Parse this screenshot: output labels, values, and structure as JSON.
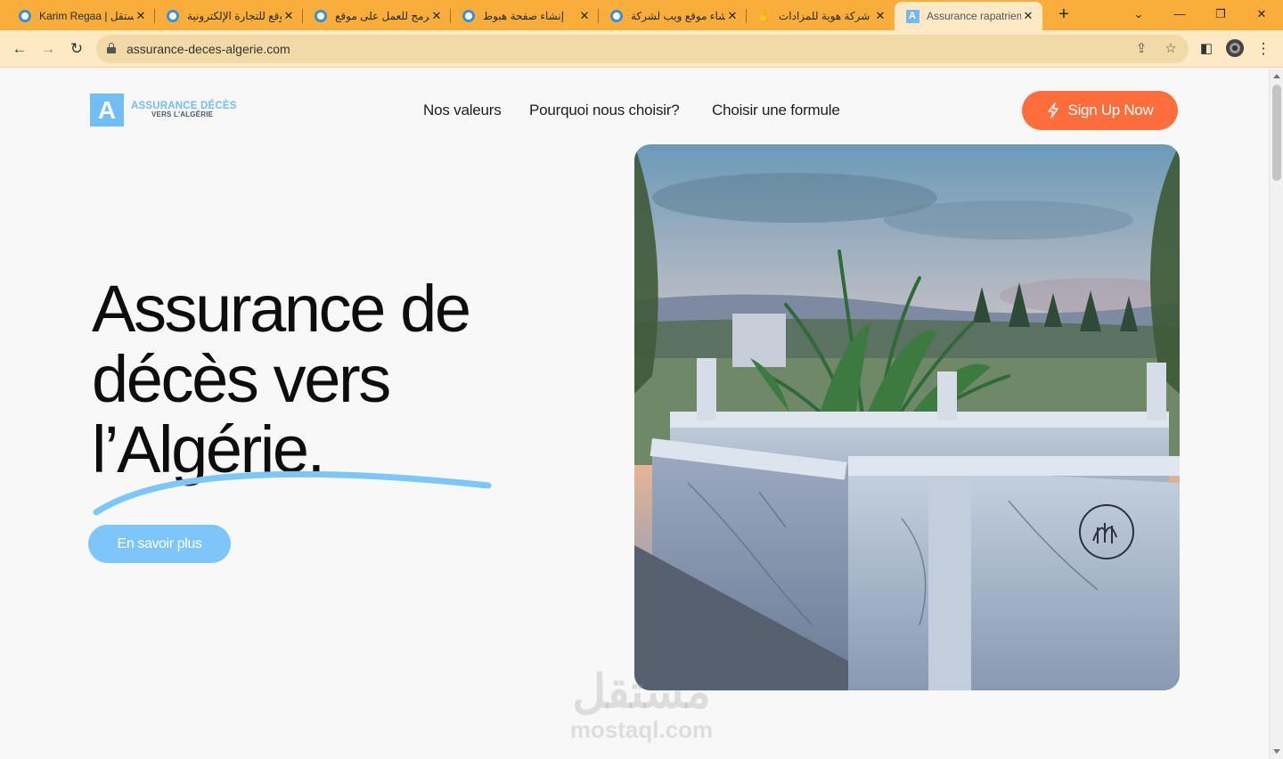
{
  "browser": {
    "tabs": [
      {
        "title": "Karim Regaa | مستقل",
        "favicon": "mostaql-ring-icon",
        "active": false
      },
      {
        "title": "موقع للتجارة الإلكترونية",
        "favicon": "mostaql-ring-icon",
        "active": false
      },
      {
        "title": "مبرمج للعمل على موقع",
        "favicon": "mostaql-ring-icon",
        "active": false
      },
      {
        "title": "إنشاء صفحة هبوط",
        "favicon": "mostaql-ring-icon",
        "active": false
      },
      {
        "title": "إنشاء موقع ويب لشركة",
        "favicon": "mostaql-ring-icon",
        "active": false
      },
      {
        "title": "شركة هوية للمزادات",
        "favicon": "hand-logo-icon",
        "active": false
      },
      {
        "title": "Assurance rapatriement",
        "favicon": "letter-a-icon",
        "active": true
      }
    ],
    "new_tab_glyph": "+",
    "close_glyph": "✕",
    "url": "assurance-deces-algerie.com"
  },
  "site": {
    "logo": {
      "mark": "A",
      "line1": "ASSURANCE DÉCÈS",
      "line2": "VERS L'ALGÉRIE"
    },
    "nav": [
      "Nos valeurs",
      "Pourquoi nous choisir?",
      "Choisir une formule"
    ],
    "signup_label": "Sign Up Now",
    "hero_title_lines": [
      "Assurance de",
      "décès vers",
      "l’Algérie."
    ],
    "cta_label": "En savoir plus"
  },
  "watermark": {
    "arabic": "مستقل",
    "latin": "mostaql.com"
  },
  "colors": {
    "tab_strip": "#f9ae3b",
    "toolbar": "#fde9c3",
    "brand_blue": "#72bdf5",
    "signup_orange": "#fd6e3c",
    "cta_blue": "#7cc6f9",
    "swoosh_blue": "#7cc6f9"
  }
}
